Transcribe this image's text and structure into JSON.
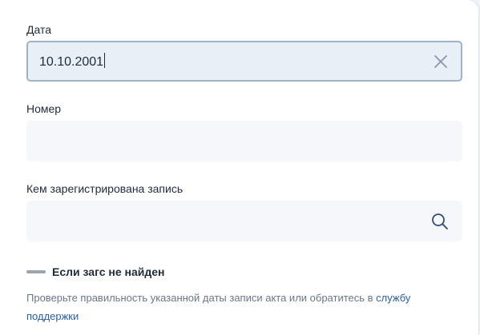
{
  "form": {
    "date": {
      "label": "Дата",
      "value": "10.10.2001",
      "clear_icon": "close-icon"
    },
    "number": {
      "label": "Номер",
      "value": ""
    },
    "registrar": {
      "label": "Кем зарегистрирована запись",
      "value": "",
      "search_icon": "search-icon"
    }
  },
  "not_found": {
    "title": "Если загс не найден",
    "help_text": "Проверьте правильность указанной даты записи акта или обратитесь в ",
    "help_link": "службу поддержки"
  },
  "colors": {
    "text": "#1f2a3c",
    "muted": "#6b7789",
    "link": "#2a5fa8",
    "field_bg": "#f5f7fa",
    "active_border": "#9fb3c9"
  }
}
